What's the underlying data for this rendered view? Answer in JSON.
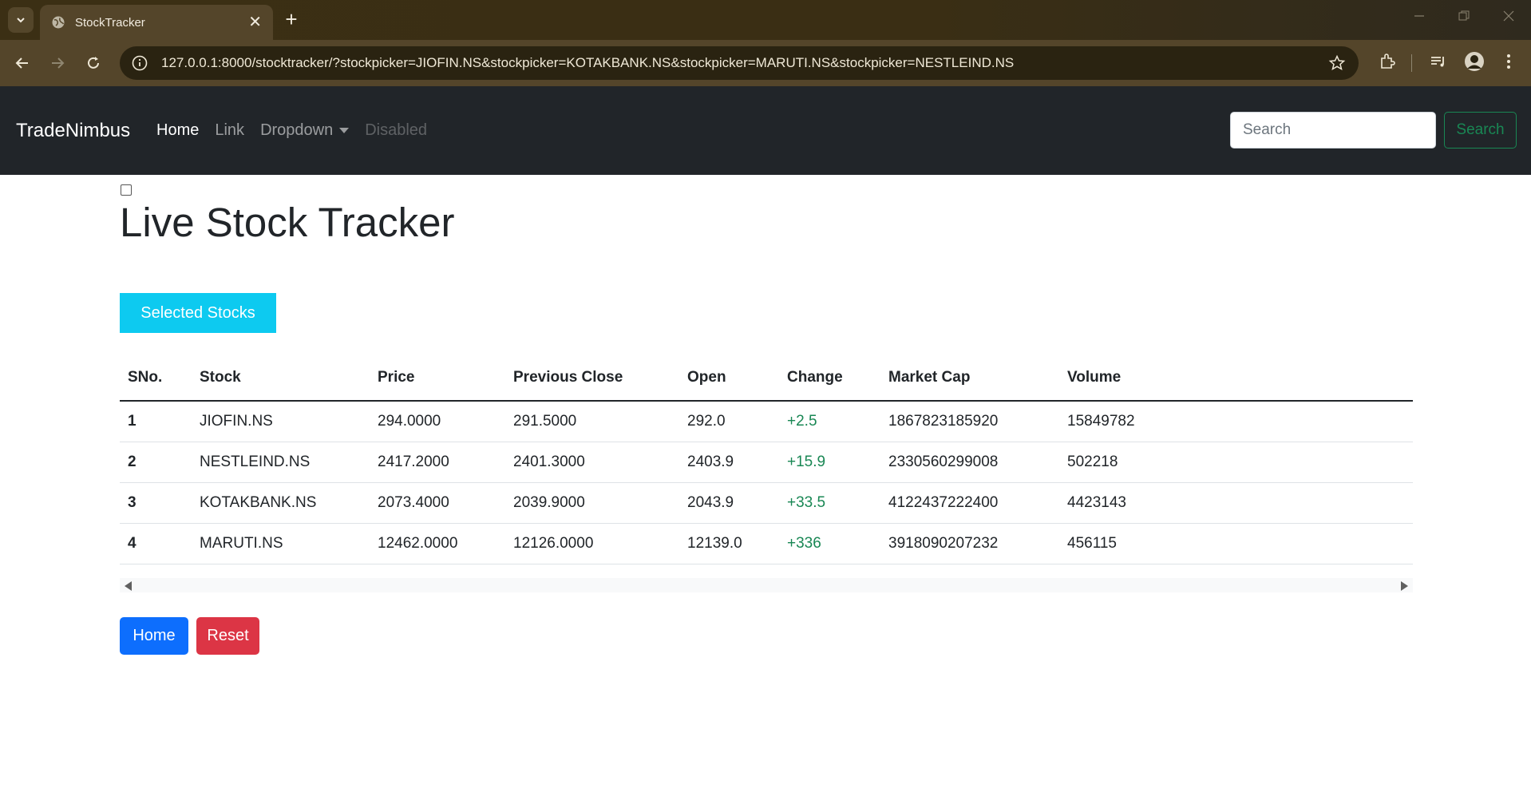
{
  "browser": {
    "tab_title": "StockTracker",
    "url": "127.0.0.1:8000/stocktracker/?stockpicker=JIOFIN.NS&stockpicker=KOTAKBANK.NS&stockpicker=MARUTI.NS&stockpicker=NESTLEIND.NS",
    "new_tab": "+",
    "tab_close": "✕"
  },
  "navbar": {
    "brand": "TradeNimbus",
    "links": [
      {
        "label": "Home"
      },
      {
        "label": "Link"
      },
      {
        "label": "Dropdown"
      },
      {
        "label": "Disabled"
      }
    ],
    "search_placeholder": "Search",
    "search_button": "Search"
  },
  "main": {
    "title": "Live Stock Tracker",
    "selected_button": "Selected Stocks",
    "table": {
      "headers": [
        "SNo.",
        "Stock",
        "Price",
        "Previous Close",
        "Open",
        "Change",
        "Market Cap",
        "Volume"
      ],
      "rows": [
        {
          "sno": "1",
          "stock": "JIOFIN.NS",
          "price": "294.0000",
          "prev_close": "291.5000",
          "open": "292.0",
          "change": "+2.5",
          "market_cap": "1867823185920",
          "volume": "15849782"
        },
        {
          "sno": "2",
          "stock": "NESTLEIND.NS",
          "price": "2417.2000",
          "prev_close": "2401.3000",
          "open": "2403.9",
          "change": "+15.9",
          "market_cap": "2330560299008",
          "volume": "502218"
        },
        {
          "sno": "3",
          "stock": "KOTAKBANK.NS",
          "price": "2073.4000",
          "prev_close": "2039.9000",
          "open": "2043.9",
          "change": "+33.5",
          "market_cap": "4122437222400",
          "volume": "4423143"
        },
        {
          "sno": "4",
          "stock": "MARUTI.NS",
          "price": "12462.0000",
          "prev_close": "12126.0000",
          "open": "12139.0",
          "change": "+336",
          "market_cap": "3918090207232",
          "volume": "456115"
        }
      ]
    },
    "home_button": "Home",
    "reset_button": "Reset"
  },
  "colors": {
    "navbar_bg": "#212529",
    "info": "#0dcaf0",
    "primary": "#0d6efd",
    "danger": "#dc3545",
    "success": "#198754"
  }
}
